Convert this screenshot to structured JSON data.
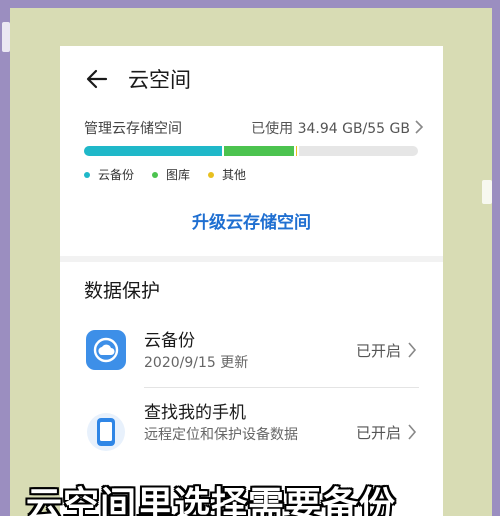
{
  "header": {
    "title": "云空间"
  },
  "storage": {
    "label": "管理云存储空间",
    "used_text": "已使用 34.94 GB/55 GB",
    "segments": [
      {
        "name": "云备份",
        "fraction": 0.42,
        "color": "#1fb8c9"
      },
      {
        "name": "图库",
        "fraction": 0.215,
        "color": "#4cc34f"
      },
      {
        "name": "其他",
        "fraction": 0.008,
        "color": "#e8c020"
      }
    ],
    "legend": [
      "云备份",
      "图库",
      "其他"
    ]
  },
  "upgrade_label": "升级云存储空间",
  "data_protection": {
    "section_title": "数据保护",
    "items": [
      {
        "title": "云备份",
        "subtitle": "2020/9/15 更新",
        "status": "已开启",
        "icon": "cloud-backup-icon"
      },
      {
        "title": "查找我的手机",
        "subtitle": "远程定位和保护设备数据",
        "status": "已开启",
        "icon": "find-phone-icon"
      }
    ]
  },
  "caption": "云空间里选择需要备份",
  "colors": {
    "accent": "#1f6fd1",
    "backdrop": "#d8dcb4",
    "frame": "#9b8ec0"
  }
}
